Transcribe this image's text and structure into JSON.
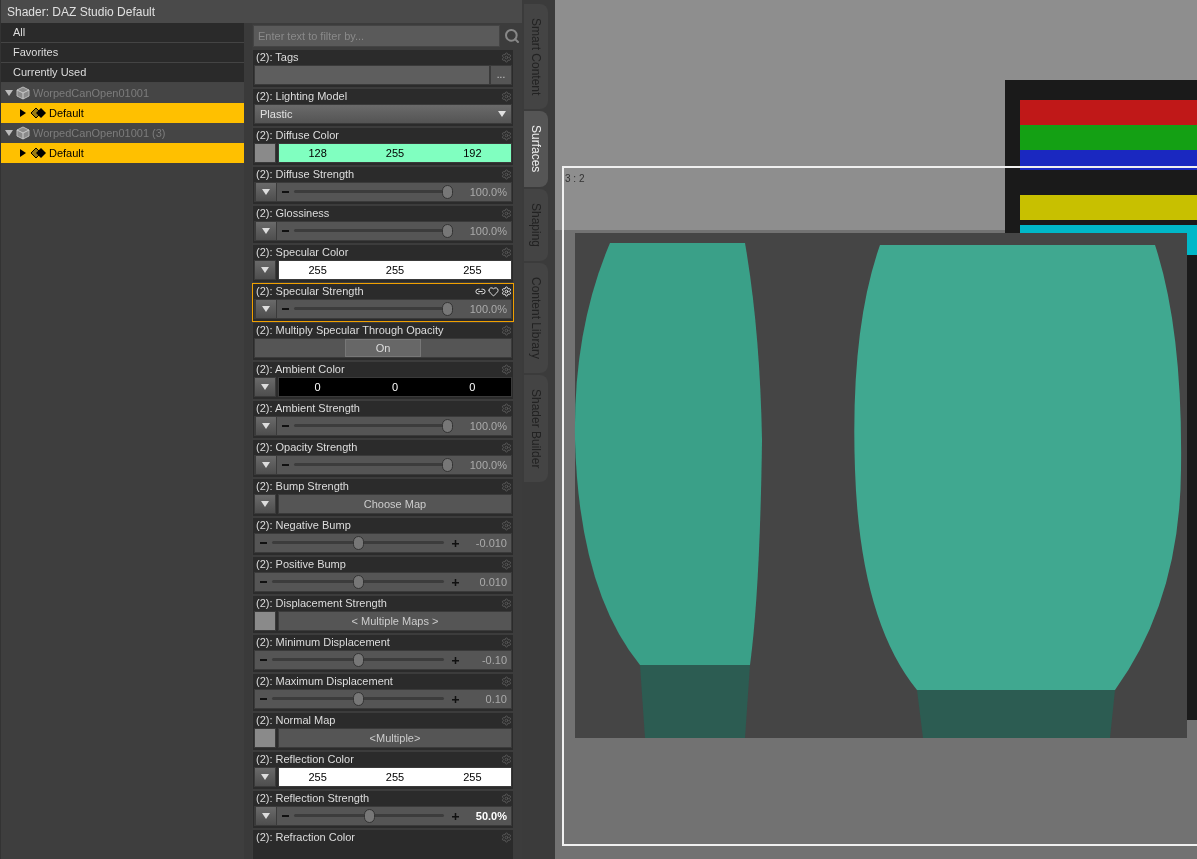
{
  "panel_title": "Shader: DAZ Studio Default",
  "categories": [
    {
      "label": "All",
      "selected": false
    },
    {
      "label": "Favorites",
      "selected": false
    },
    {
      "label": "Currently Used",
      "selected": false
    }
  ],
  "tree": [
    {
      "label": "WorpedCanOpen01001",
      "expanded": true,
      "children": [
        {
          "label": "Default",
          "selected": true,
          "expanded": false
        }
      ]
    },
    {
      "label": "WorpedCanOpen01001 (3)",
      "expanded": true,
      "children": [
        {
          "label": "Default",
          "selected": true,
          "expanded": false
        }
      ]
    }
  ],
  "filter": {
    "placeholder": "Enter text to filter by..."
  },
  "properties": [
    {
      "title": "(2): Tags",
      "kind": "tags",
      "button": "...",
      "selected": false
    },
    {
      "title": "(2): Lighting Model",
      "kind": "dropdown",
      "value": "Plastic",
      "selected": false
    },
    {
      "title": "(2): Diffuse Color",
      "kind": "color",
      "values": [
        "128",
        "255",
        "192"
      ],
      "color": "#80ffc0",
      "menu": false,
      "selected": false
    },
    {
      "title": "(2): Diffuse Strength",
      "kind": "slider",
      "level": 1,
      "reading": "100.0%",
      "menu": true,
      "plus": false,
      "modified": false,
      "selected": false
    },
    {
      "title": "(2): Glossiness",
      "kind": "slider",
      "level": 1,
      "reading": "100.0%",
      "menu": true,
      "plus": false,
      "modified": false,
      "selected": false
    },
    {
      "title": "(2): Specular Color",
      "kind": "color",
      "values": [
        "255",
        "255",
        "255"
      ],
      "color": "#ffffff",
      "menu": true,
      "selected": false
    },
    {
      "title": "(2): Specular Strength",
      "kind": "slider",
      "level": 1,
      "reading": "100.0%",
      "menu": true,
      "plus": false,
      "modified": false,
      "selected": true
    },
    {
      "title": "(2): Multiply Specular Through Opacity",
      "kind": "toggle",
      "value": "On",
      "on": true,
      "selected": false
    },
    {
      "title": "(2): Ambient Color",
      "kind": "color",
      "values": [
        "0",
        "0",
        "0"
      ],
      "color": "#000000",
      "menu": true,
      "selected": false
    },
    {
      "title": "(2): Ambient Strength",
      "kind": "slider",
      "level": 1,
      "reading": "100.0%",
      "menu": true,
      "plus": false,
      "modified": false,
      "selected": false
    },
    {
      "title": "(2): Opacity Strength",
      "kind": "slider",
      "level": 1,
      "reading": "100.0%",
      "menu": true,
      "plus": false,
      "modified": false,
      "selected": false
    },
    {
      "title": "(2): Bump Strength",
      "kind": "map",
      "value": "Choose Map",
      "menu": true,
      "selected": false
    },
    {
      "title": "(2): Negative Bump",
      "kind": "slider",
      "level": 0.5,
      "reading": "-0.010",
      "menu": false,
      "plus": true,
      "modified": false,
      "selected": false
    },
    {
      "title": "(2): Positive Bump",
      "kind": "slider",
      "level": 0.5,
      "reading": "0.010",
      "menu": false,
      "plus": true,
      "modified": false,
      "selected": false
    },
    {
      "title": "(2): Displacement Strength",
      "kind": "map",
      "value": "< Multiple Maps >",
      "menu": false,
      "selected": false
    },
    {
      "title": "(2): Minimum Displacement",
      "kind": "slider",
      "level": 0.5,
      "reading": "-0.10",
      "menu": false,
      "plus": true,
      "modified": false,
      "selected": false
    },
    {
      "title": "(2): Maximum Displacement",
      "kind": "slider",
      "level": 0.5,
      "reading": "0.10",
      "menu": false,
      "plus": true,
      "modified": false,
      "selected": false
    },
    {
      "title": "(2): Normal Map",
      "kind": "map",
      "value": "<Multiple>",
      "menu": false,
      "selected": false
    },
    {
      "title": "(2): Reflection Color",
      "kind": "color",
      "values": [
        "255",
        "255",
        "255"
      ],
      "color": "#ffffff",
      "menu": true,
      "selected": false
    },
    {
      "title": "(2): Reflection Strength",
      "kind": "slider",
      "level": 0.5,
      "reading": "50.0%",
      "menu": true,
      "plus": true,
      "modified": true,
      "selected": false
    },
    {
      "title": "(2): Refraction Color",
      "kind": "partial",
      "selected": false
    }
  ],
  "side_tabs": [
    {
      "label": "Smart Content",
      "selected": false
    },
    {
      "label": "Surfaces",
      "selected": true
    },
    {
      "label": "Shaping",
      "selected": false
    },
    {
      "label": "Content Library",
      "selected": false
    },
    {
      "label": "Shader Builder",
      "selected": false
    }
  ],
  "viewport": {
    "aspect_label": "3 : 2"
  }
}
